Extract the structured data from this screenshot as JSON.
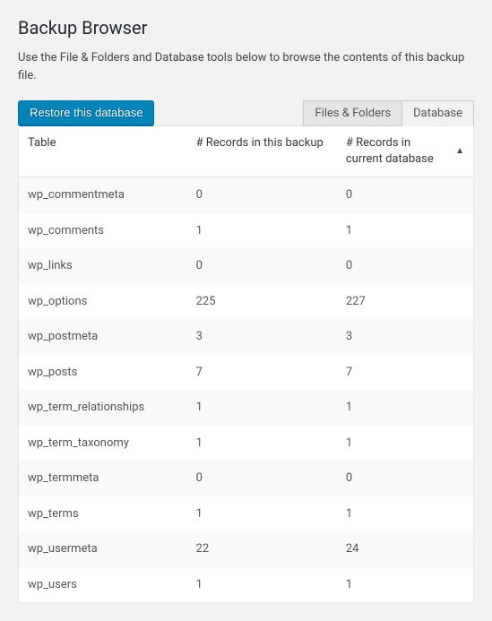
{
  "page": {
    "title": "Backup Browser",
    "description": "Use the File & Folders and Database tools below to browse the contents of this backup file."
  },
  "actions": {
    "restore_button": "Restore this database"
  },
  "tabs": {
    "files_folders": "Files & Folders",
    "database": "Database"
  },
  "table": {
    "headers": {
      "table": "Table",
      "records_backup": "# Records in this backup",
      "records_current": "# Records in current database"
    },
    "rows": [
      {
        "name": "wp_commentmeta",
        "backup": "0",
        "current": "0"
      },
      {
        "name": "wp_comments",
        "backup": "1",
        "current": "1"
      },
      {
        "name": "wp_links",
        "backup": "0",
        "current": "0"
      },
      {
        "name": "wp_options",
        "backup": "225",
        "current": "227"
      },
      {
        "name": "wp_postmeta",
        "backup": "3",
        "current": "3"
      },
      {
        "name": "wp_posts",
        "backup": "7",
        "current": "7"
      },
      {
        "name": "wp_term_relationships",
        "backup": "1",
        "current": "1"
      },
      {
        "name": "wp_term_taxonomy",
        "backup": "1",
        "current": "1"
      },
      {
        "name": "wp_termmeta",
        "backup": "0",
        "current": "0"
      },
      {
        "name": "wp_terms",
        "backup": "1",
        "current": "1"
      },
      {
        "name": "wp_usermeta",
        "backup": "22",
        "current": "24"
      },
      {
        "name": "wp_users",
        "backup": "1",
        "current": "1"
      }
    ]
  }
}
